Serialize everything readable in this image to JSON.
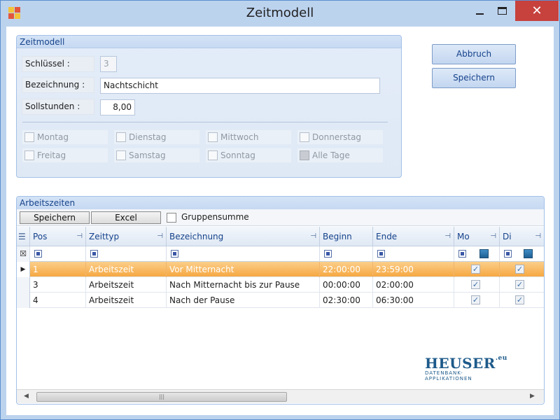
{
  "window": {
    "title": "Zeitmodell",
    "close_glyph": "✕"
  },
  "zeitmodell": {
    "header": "Zeitmodell",
    "schluessel_label": "Schlüssel :",
    "schluessel_value": "3",
    "bezeichnung_label": "Bezeichnung :",
    "bezeichnung_value": "Nachtschicht",
    "sollstunden_label": "Sollstunden :",
    "sollstunden_value": "8,00",
    "days": [
      {
        "label": "Montag"
      },
      {
        "label": "Dienstag"
      },
      {
        "label": "Mittwoch"
      },
      {
        "label": "Donnerstag"
      },
      {
        "label": "Freitag"
      },
      {
        "label": "Samstag"
      },
      {
        "label": "Sonntag"
      },
      {
        "label": "Alle Tage"
      }
    ]
  },
  "actions": {
    "abbruch": "Abbruch",
    "speichern": "Speichern"
  },
  "arbeitszeiten": {
    "header": "Arbeitszeiten",
    "toolbar": {
      "speichern": "Speichern",
      "excel": "Excel",
      "gruppensumme": "Gruppensumme"
    },
    "columns": [
      "Pos",
      "Zeittyp",
      "Bezeichnung",
      "Beginn",
      "Ende",
      "Mo",
      "Di"
    ],
    "rows": [
      {
        "pos": "1",
        "zeittyp": "Arbeitszeit",
        "bezeichnung": "Vor Mitternacht",
        "beginn": "22:00:00",
        "ende": "23:59:00",
        "mo": "✓",
        "di": "✓"
      },
      {
        "pos": "3",
        "zeittyp": "Arbeitszeit",
        "bezeichnung": "Nach Mitternacht bis zur Pause",
        "beginn": "00:00:00",
        "ende": "02:00:00",
        "mo": "✓",
        "di": "✓"
      },
      {
        "pos": "4",
        "zeittyp": "Arbeitszeit",
        "bezeichnung": "Nach der Pause",
        "beginn": "02:30:00",
        "ende": "06:30:00",
        "mo": "✓",
        "di": "✓"
      }
    ],
    "scroll_grip": "|||"
  },
  "logo": {
    "main": "HEUSER",
    "suffix": ".eu",
    "sub": "DATENBANK-APPLIKATIONEN"
  }
}
